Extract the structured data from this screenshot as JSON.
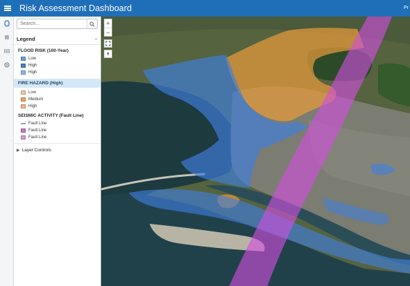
{
  "header": {
    "title": "Risk Assessment Dashboard",
    "user_label": "Pr",
    "menu_icon": "hamburger-menu-icon"
  },
  "rail": {
    "icons": [
      "layers-icon",
      "legend-icon",
      "bookmark-icon",
      "settings-icon"
    ]
  },
  "panel": {
    "search_placeholder": "Search...",
    "legend_title": "Legend",
    "groups": [
      {
        "title": "FLOOD RISK (100-Year)",
        "items": [
          {
            "label": "Low",
            "color": "#6f9fd6"
          },
          {
            "label": "High",
            "color": "#4a7fc4"
          },
          {
            "label": "High",
            "color": "#8fb6e2"
          }
        ]
      },
      {
        "title": "FIRE HAZARD (High)",
        "items": [
          {
            "label": "Low",
            "color": "#f2c89a"
          },
          {
            "label": "Medium",
            "color": "#e9a766"
          },
          {
            "label": "High",
            "color": "#f0b98a"
          }
        ]
      },
      {
        "title": "SEISMIC ACTIVITY (Fault Line)",
        "items": [
          {
            "label": "Fault Line",
            "color": "#9aa0b8"
          },
          {
            "label": "Fault Line",
            "color": "#c978c6"
          },
          {
            "label": "Fault Line",
            "color": "#d79bd4"
          }
        ]
      }
    ],
    "layer_controls_label": "Layer Controls"
  },
  "map_controls": {
    "zoom_in": "+",
    "zoom_out": "−"
  },
  "colors": {
    "header": "#1f6fb8",
    "flood_overlay": "#3f7fe0",
    "fire_overlay": "#e89a3c",
    "seismic_overlay": "#d24fe0",
    "water": "#1c3a3e",
    "land": "#52603f"
  }
}
